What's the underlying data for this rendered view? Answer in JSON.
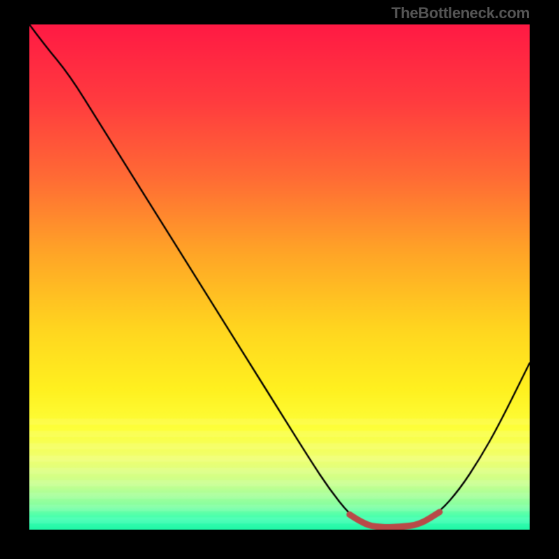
{
  "attribution": "TheBottleneck.com",
  "chart_data": {
    "type": "line",
    "title": "",
    "xlabel": "",
    "ylabel": "",
    "xlim": [
      0,
      100
    ],
    "ylim": [
      0,
      100
    ],
    "series": [
      {
        "name": "bottleneck-curve",
        "color": "#000000",
        "x": [
          0,
          3,
          8,
          14,
          20,
          26,
          32,
          38,
          44,
          50,
          56,
          60,
          64,
          67,
          70,
          74,
          78,
          82,
          86,
          90,
          94,
          100
        ],
        "y": [
          100,
          96,
          90,
          80.5,
          71,
          61.5,
          52,
          42.5,
          33,
          23.5,
          14,
          8,
          3,
          1,
          0.5,
          0.5,
          1,
          3.5,
          8,
          14,
          21,
          33
        ]
      },
      {
        "name": "optimal-range-highlight",
        "color": "#b94a48",
        "x": [
          64,
          67,
          70,
          74,
          78,
          82
        ],
        "y": [
          3,
          1,
          0.5,
          0.5,
          1,
          3.5
        ]
      }
    ],
    "background_gradient": {
      "type": "vertical",
      "stops": [
        {
          "pos": 0.0,
          "color": "#ff1a44"
        },
        {
          "pos": 0.15,
          "color": "#ff3b3f"
        },
        {
          "pos": 0.3,
          "color": "#ff6a35"
        },
        {
          "pos": 0.45,
          "color": "#ffa427"
        },
        {
          "pos": 0.6,
          "color": "#ffd51f"
        },
        {
          "pos": 0.72,
          "color": "#fff01f"
        },
        {
          "pos": 0.8,
          "color": "#fdff3a"
        },
        {
          "pos": 0.86,
          "color": "#f0ff70"
        },
        {
          "pos": 0.91,
          "color": "#c8ff8f"
        },
        {
          "pos": 0.95,
          "color": "#8affa0"
        },
        {
          "pos": 0.98,
          "color": "#3affb0"
        },
        {
          "pos": 1.0,
          "color": "#20f7a7"
        }
      ]
    },
    "band_overlay": {
      "note": "horizontal pale banding near bottom, alpha striping",
      "y_start": 0.78,
      "y_end": 1.0,
      "stripe_alpha": 0.1,
      "stripe_count": 18
    }
  }
}
